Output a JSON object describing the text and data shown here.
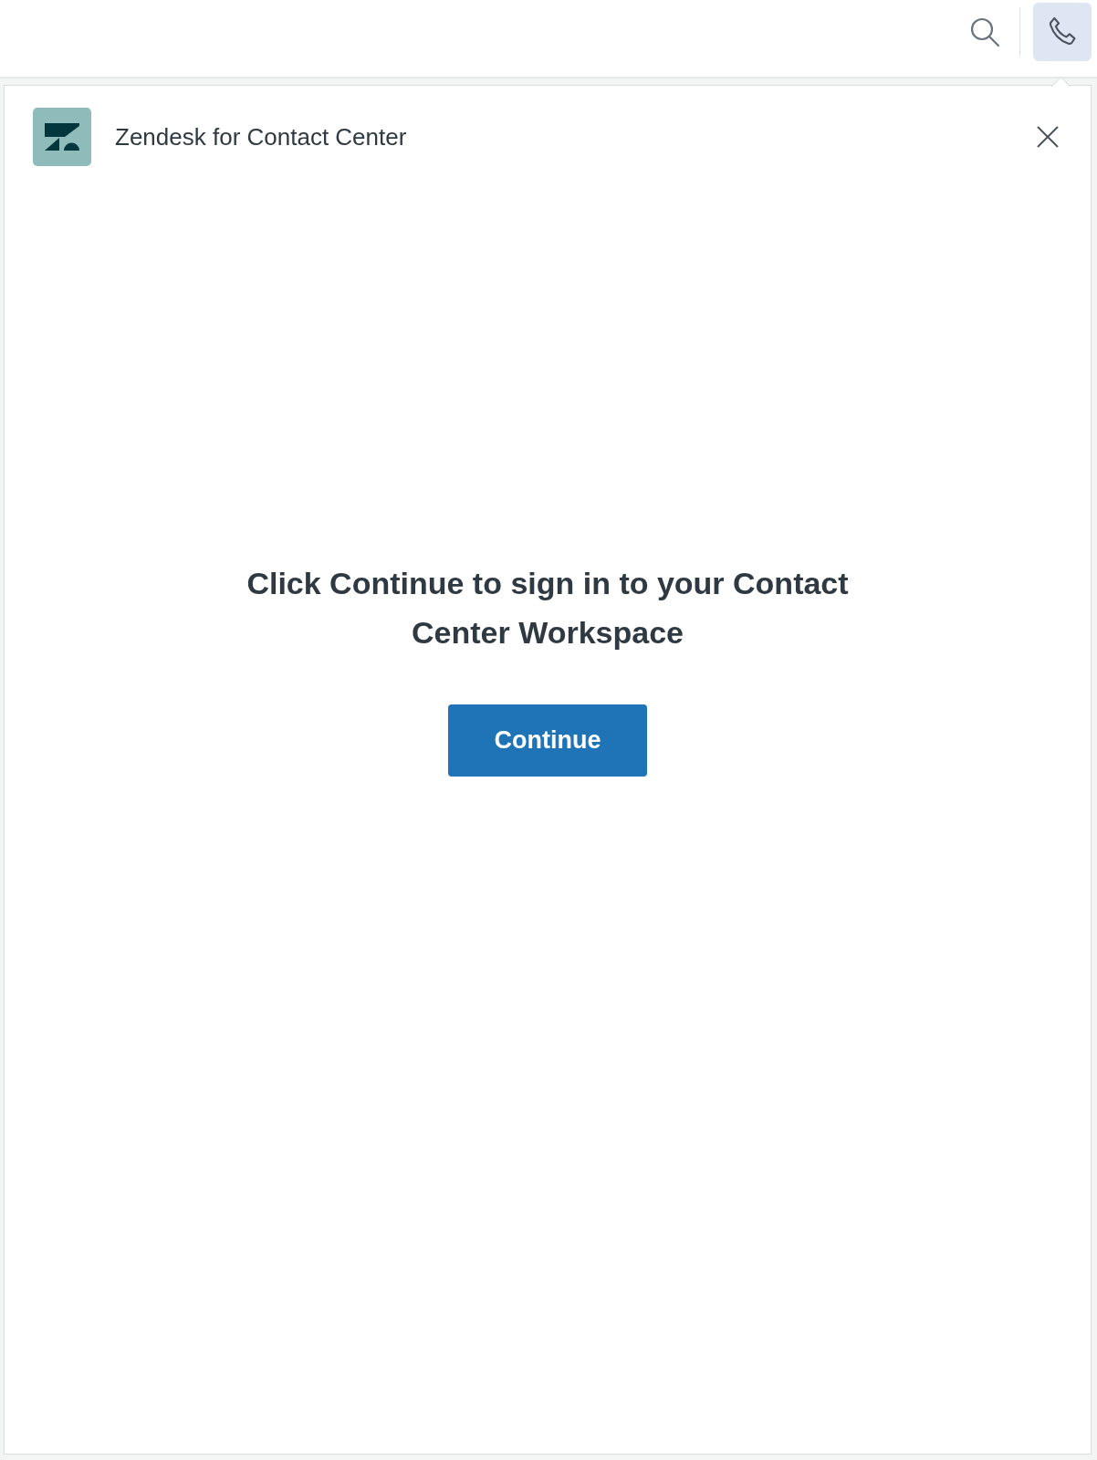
{
  "top_bar": {
    "buttons": [
      {
        "kind": "search",
        "selected": false
      },
      {
        "kind": "phone",
        "selected": true
      }
    ]
  },
  "panel": {
    "title": "Zendesk for Contact Center",
    "message": "Click Continue to sign in to your Contact Center Workspace",
    "button": "Continue"
  }
}
